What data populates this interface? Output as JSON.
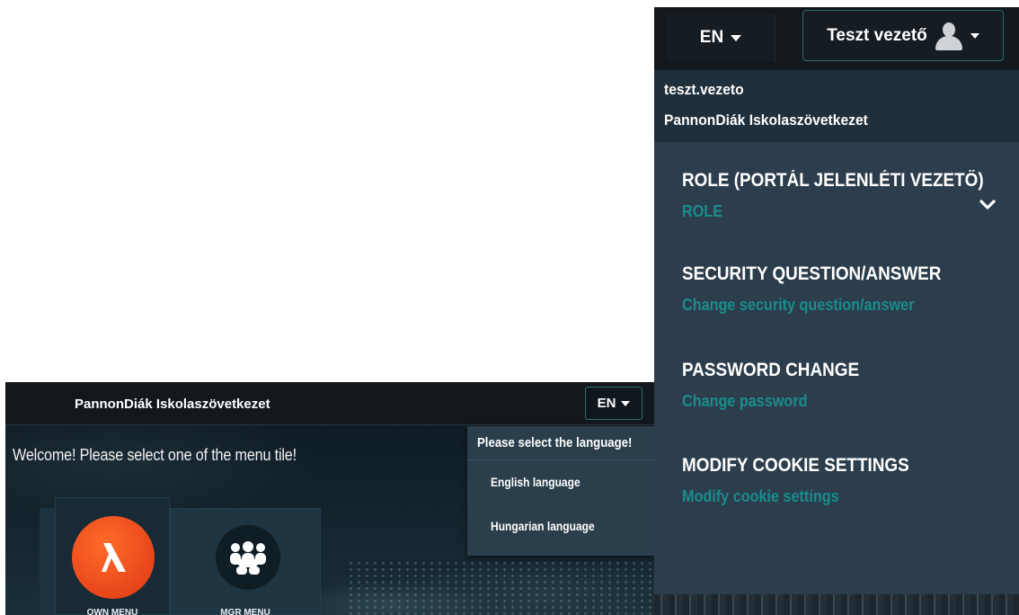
{
  "left": {
    "company_name": "PannonDiák Iskolaszövetkezet",
    "lang_button": "EN",
    "welcome": "Welcome! Please select one of the menu tile!",
    "tiles": [
      {
        "label": "OWN MENU",
        "icon": "own-menu-logo-icon"
      },
      {
        "label": "MGR MENU",
        "icon": "group-people-icon"
      }
    ],
    "language_dropdown": {
      "title": "Please select the language!",
      "options": [
        "English language",
        "Hungarian language"
      ]
    }
  },
  "right": {
    "lang_button": "EN",
    "user_button": "Teszt vezető",
    "username": "teszt.vezeto",
    "company": "PannonDiák Iskolaszövetkezet",
    "sections": [
      {
        "title": "ROLE (PORTÁL JELENLÉTI VEZETŐ)",
        "subtitle": "ROLE"
      },
      {
        "title": "SECURITY QUESTION/ANSWER",
        "subtitle": "Change security question/answer"
      },
      {
        "title": "PASSWORD CHANGE",
        "subtitle": "Change password"
      },
      {
        "title": "MODIFY COOKIE SETTINGS",
        "subtitle": "Modify cookie settings"
      }
    ]
  },
  "colors": {
    "accent_teal": "#1a8c8a",
    "panel_bg": "#2c3e4d",
    "topbar_bg": "#13181d",
    "own_logo": "#e8461a"
  }
}
